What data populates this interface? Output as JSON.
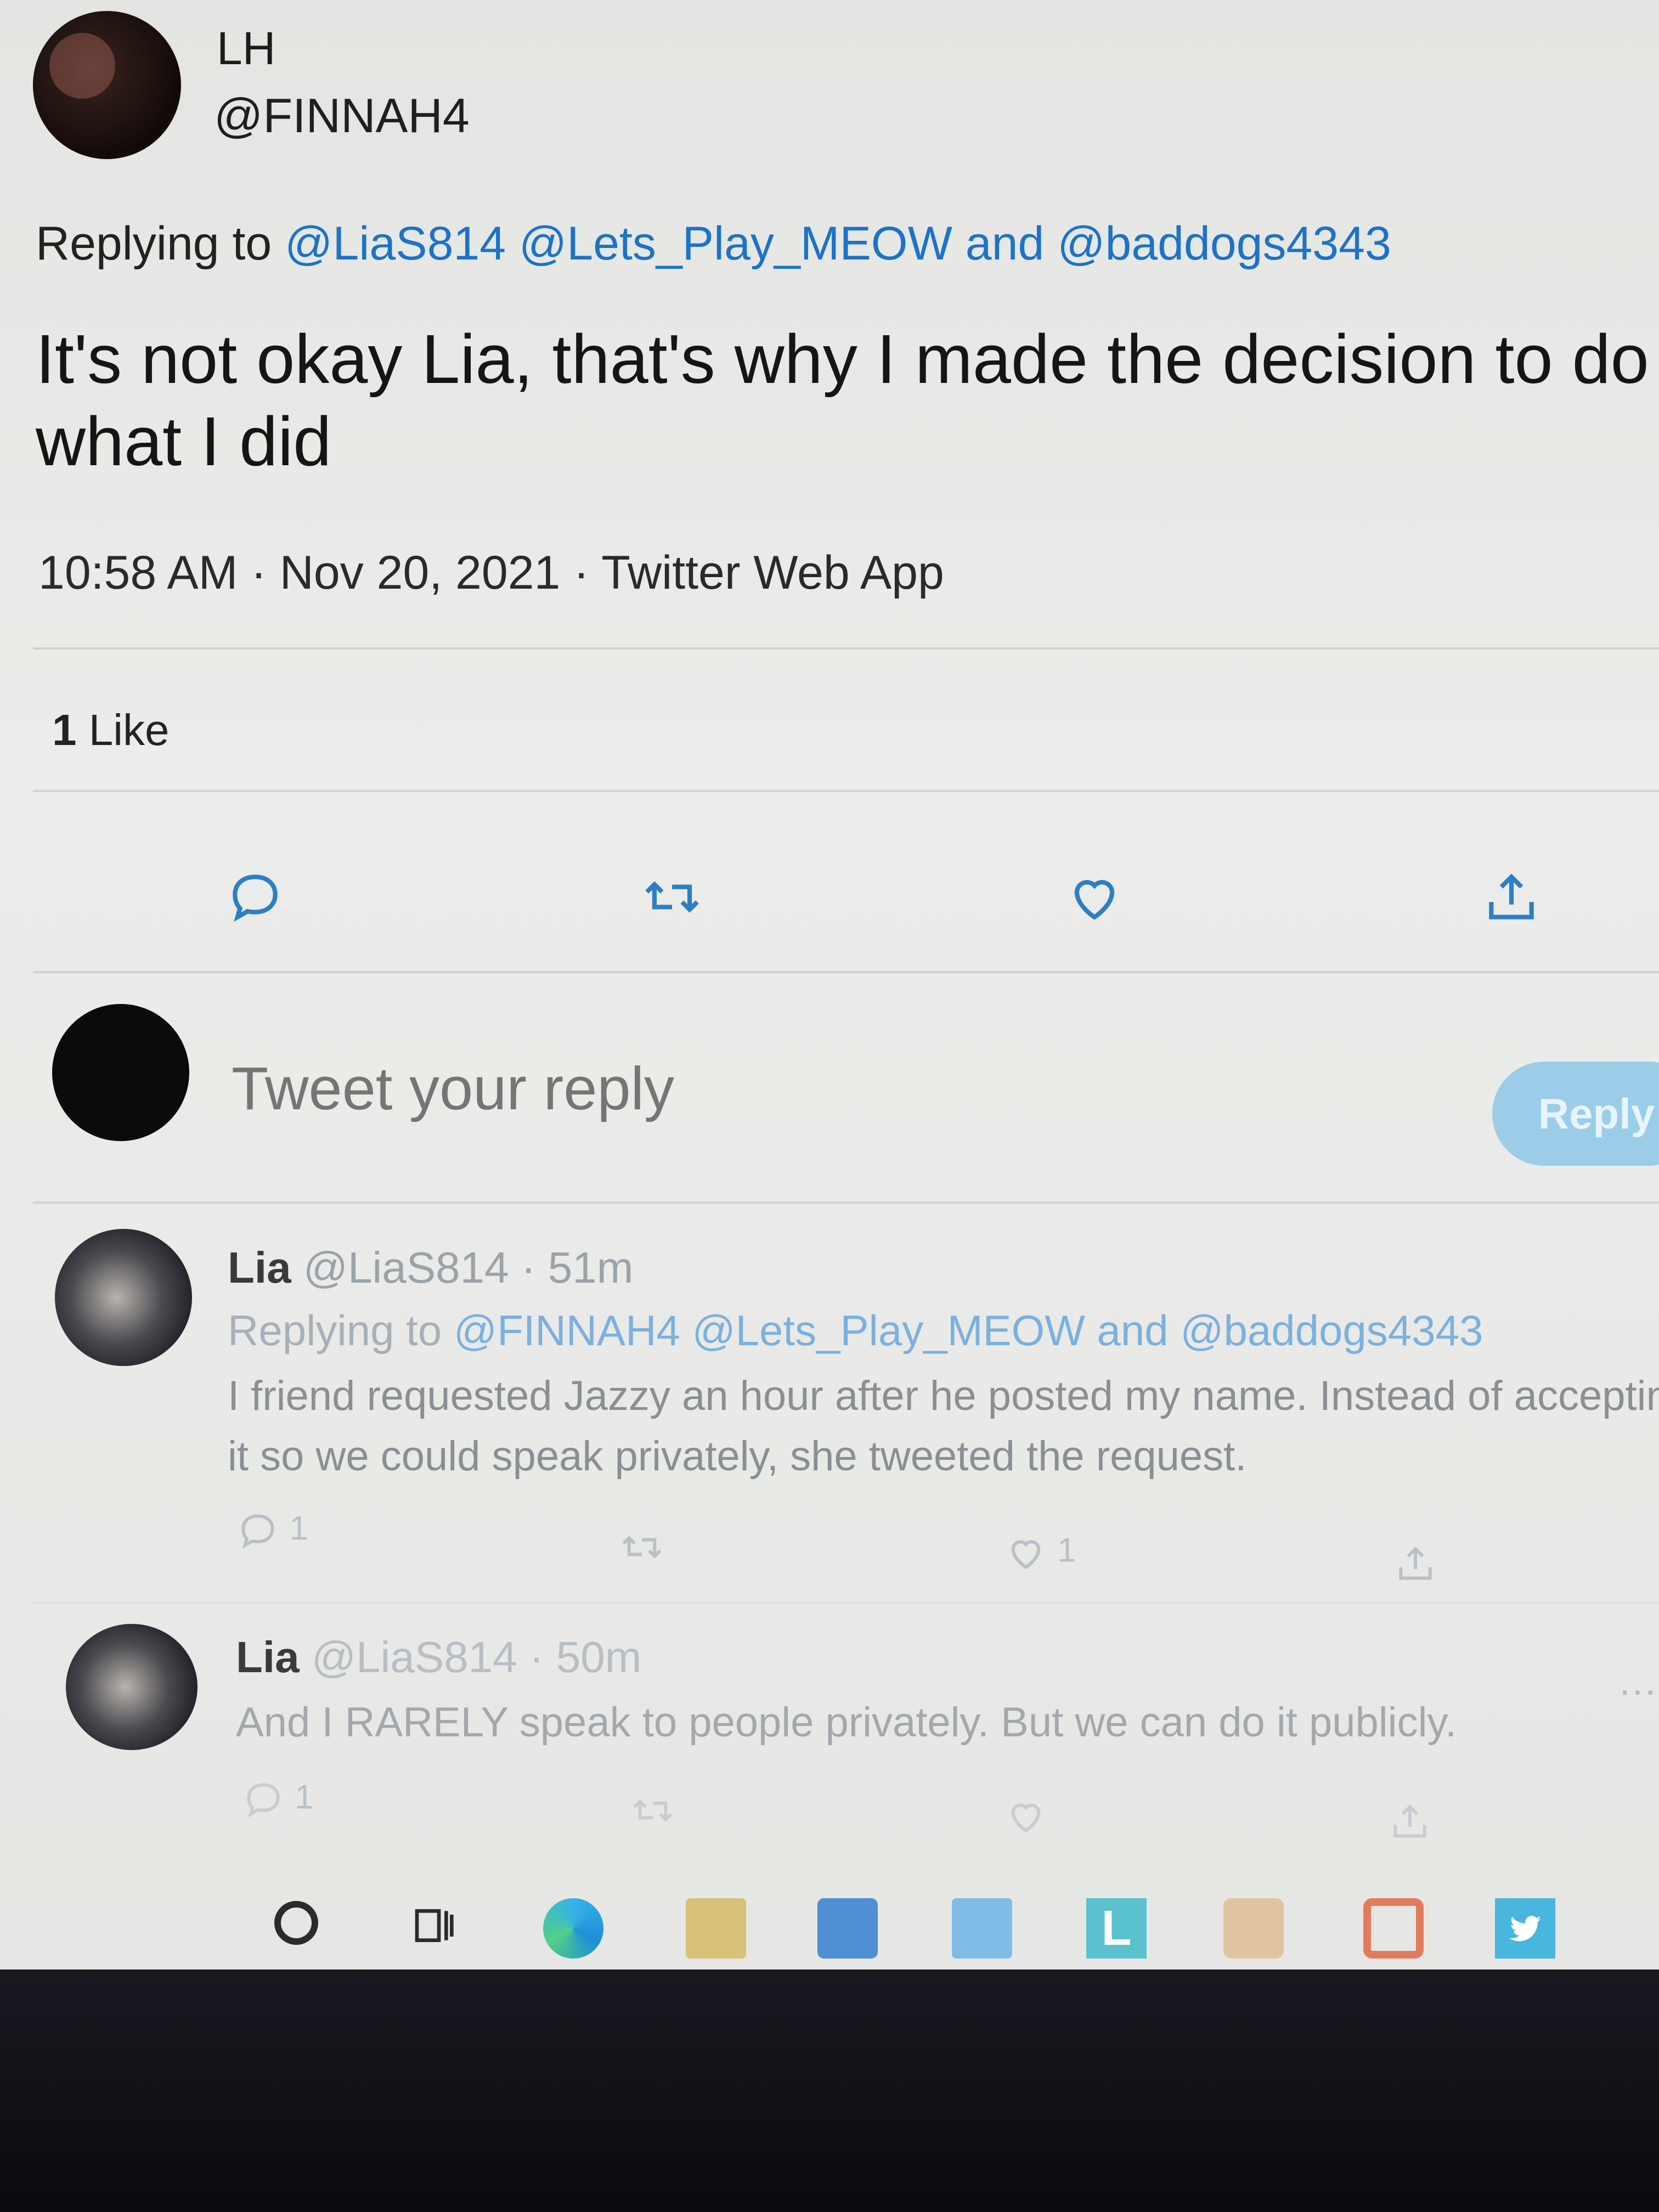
{
  "tweet": {
    "author_name": "LH",
    "author_handle": "@FINNAH4",
    "replying_prefix": "Replying to",
    "replying_to": [
      "@LiaS814",
      "@Lets_Play_MEOW",
      "and",
      "@baddogs4343"
    ],
    "text": "It's not okay Lia, that's why I made the decision to do what I did",
    "timestamp": "10:58 AM · Nov 20, 2021 · Twitter Web App",
    "likes_count": "1",
    "likes_label": "Like"
  },
  "composer": {
    "placeholder": "Tweet your reply",
    "reply_button": "Reply"
  },
  "replies": [
    {
      "name": "Lia",
      "handle_time": "@LiaS814 · 51m",
      "replying_prefix": "Replying to",
      "replying_to": "@FINNAH4 @Lets_Play_MEOW and @baddogs4343",
      "text": "I friend requested Jazzy an hour after he posted my name. Instead of accepting it so we could speak privately, she tweeted the request.",
      "reply_count": "1",
      "like_count": "1"
    },
    {
      "name": "Lia",
      "handle_time": "@LiaS814 · 50m",
      "text": "And I RARELY speak to people privately. But we can do it publicly.",
      "reply_count": "1",
      "more": "···"
    }
  ],
  "taskbar": {
    "icons": [
      "search-icon",
      "task-view-icon",
      "edge-icon",
      "file-explorer-icon",
      "store-icon",
      "mail-icon",
      "l-app-icon",
      "game-icon",
      "office-icon",
      "twitter-icon"
    ],
    "l_label": "L"
  },
  "colors": {
    "link": "#1d72c9",
    "reply_button": "#9bcde9",
    "background": "#ecedea"
  }
}
